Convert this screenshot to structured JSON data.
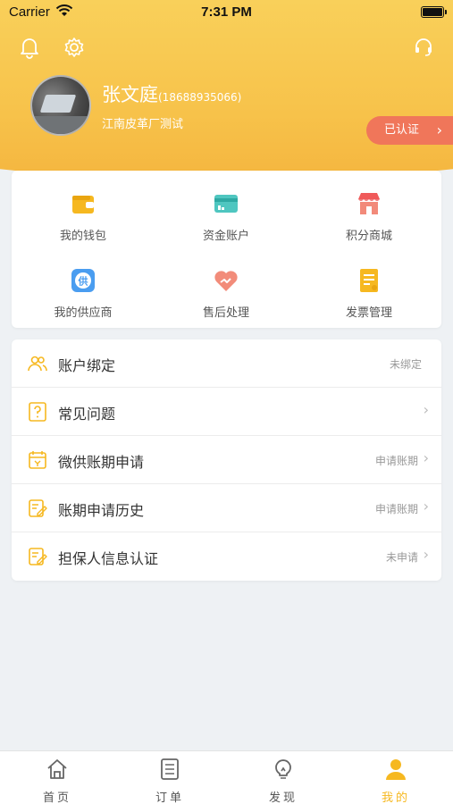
{
  "status_bar": {
    "carrier": "Carrier",
    "time": "7:31 PM"
  },
  "profile": {
    "name": "张文庭",
    "phone": "(18688935066)",
    "company": "江南皮革厂测试",
    "verified_label": "已认证",
    "verified_chevron": "›"
  },
  "grid": {
    "items": [
      {
        "label": "我的钱包",
        "icon": "wallet-icon"
      },
      {
        "label": "资金账户",
        "icon": "card-icon"
      },
      {
        "label": "积分商城",
        "icon": "shop-icon"
      },
      {
        "label": "我的供应商",
        "icon": "supplier-icon"
      },
      {
        "label": "售后处理",
        "icon": "heart-handshake-icon"
      },
      {
        "label": "发票管理",
        "icon": "invoice-icon"
      }
    ]
  },
  "menu": {
    "rows": [
      {
        "label": "账户绑定",
        "status": "未绑定",
        "chevron": ""
      },
      {
        "label": "常见问题",
        "status": "",
        "chevron": "›"
      },
      {
        "label": "微供账期申请",
        "status": "申请账期",
        "chevron": "›"
      },
      {
        "label": "账期申请历史",
        "status": "申请账期",
        "chevron": "›"
      },
      {
        "label": "担保人信息认证",
        "status": "未申请",
        "chevron": "›"
      }
    ]
  },
  "tabbar": {
    "tabs": [
      {
        "label": "首页",
        "icon": "home-icon"
      },
      {
        "label": "订单",
        "icon": "order-list-icon"
      },
      {
        "label": "发现",
        "icon": "lightbulb-icon"
      },
      {
        "label": "我的",
        "icon": "person-icon"
      }
    ],
    "active": "我的"
  },
  "colors": {
    "accent": "#f6b820",
    "header": "#f7c24a",
    "badge": "#f0765a"
  }
}
